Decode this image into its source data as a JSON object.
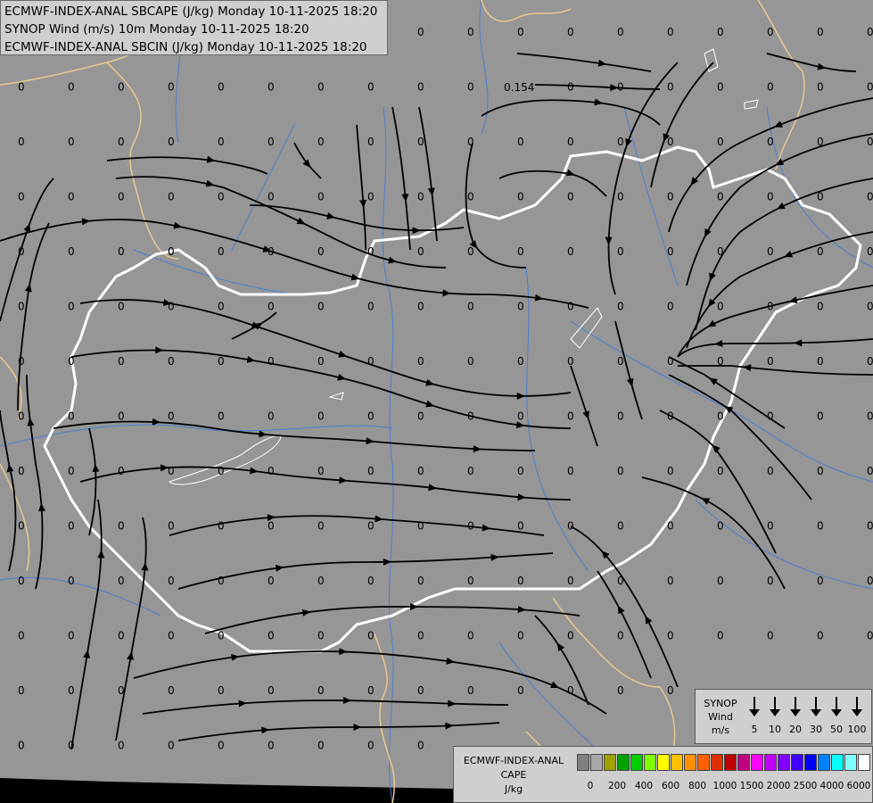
{
  "titles": {
    "line1": "ECMWF-INDEX-ANAL SBCAPE (J/kg) Monday 10-11-2025 18:20",
    "line2": "SYNOP Wind (m/s) 10m Monday 10-11-2025 18:20",
    "line3": "ECMWF-INDEX-ANAL SBCIN (J/kg) Monday 10-11-2025 18:20"
  },
  "colors": {
    "background": "#969696",
    "border_country": "#ffffff",
    "border_neighbor": "#e8c890",
    "rivers": "#4a7fd0",
    "streamlines": "#000000"
  },
  "map_values": {
    "zero": "0",
    "special": "0.154"
  },
  "wind_legend": {
    "title_line1": "SYNOP",
    "title_line2": "Wind",
    "title_line3": "m/s",
    "values": [
      "5",
      "10",
      "20",
      "30",
      "50",
      "100"
    ],
    "icon": "wind-barb-arrow-icon"
  },
  "cape_legend": {
    "title_line1": "ECMWF-INDEX-ANAL",
    "title_line2": "CAPE",
    "title_line3": "J/kg",
    "colors": [
      "#808080",
      "#a8a8a8",
      "#a0a000",
      "#00a000",
      "#00d000",
      "#80ff00",
      "#ffff00",
      "#ffc000",
      "#ff9000",
      "#ff6000",
      "#e03000",
      "#c00000",
      "#c00080",
      "#ff00ff",
      "#c000ff",
      "#8000ff",
      "#4000ff",
      "#0000ff",
      "#0080ff",
      "#00ffff",
      "#80ffff",
      "#ffffff"
    ],
    "labels": [
      "0",
      "200",
      "400",
      "600",
      "800",
      "1000",
      "1500",
      "2000",
      "2500",
      "4000",
      "6000"
    ]
  }
}
